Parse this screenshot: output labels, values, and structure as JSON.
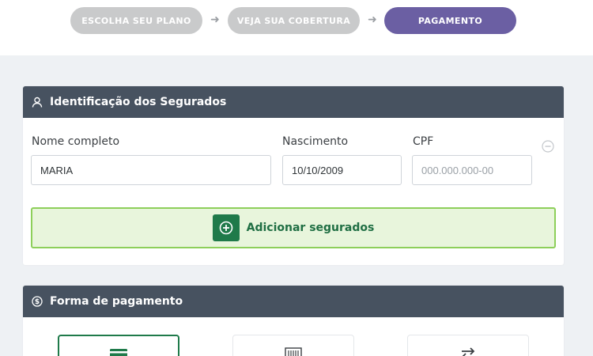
{
  "stepper": {
    "steps": [
      {
        "label": "ESCOLHA SEU PLANO",
        "state": "done"
      },
      {
        "label": "VEJA SUA COBERTURA",
        "state": "done"
      },
      {
        "label": "PAGAMENTO",
        "state": "active"
      }
    ]
  },
  "insured_section": {
    "title": "Identificação dos Segurados",
    "icon": "user-icon",
    "fields": {
      "name": {
        "label": "Nome completo",
        "value": "MARIA"
      },
      "birth": {
        "label": "Nascimento",
        "value": "10/10/2009"
      },
      "cpf": {
        "label": "CPF",
        "value": "",
        "placeholder": "000.000.000-00"
      }
    },
    "add_button": {
      "label": "Adicionar segurados",
      "icon": "plus-circle-icon"
    }
  },
  "payment_section": {
    "title": "Forma de pagamento",
    "icon": "dollar-circle-icon",
    "options": [
      {
        "icon": "credit-card-icon",
        "selected": true
      },
      {
        "icon": "barcode-icon",
        "selected": false
      },
      {
        "icon": "transfer-icon",
        "selected": false
      }
    ]
  },
  "colors": {
    "header_bg": "#475260",
    "step_active": "#6b5fa3",
    "step_done": "#c9cacb",
    "accent_green": "#1f7a4a",
    "add_box_bg": "#e8f5dc"
  }
}
